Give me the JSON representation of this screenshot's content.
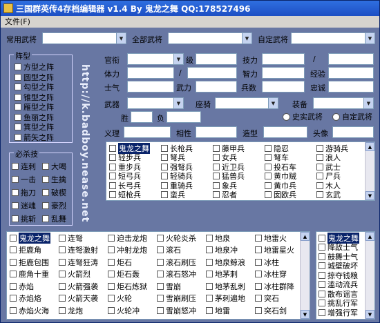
{
  "window": {
    "title": "三国群英传4存档编辑器 v1.4 By 鬼龙之舞 QQ:178527496"
  },
  "menu": {
    "file": "文件(F)"
  },
  "top_row": {
    "common_label": "常用武将",
    "all_label": "全部武将",
    "custom_label": "自定武将"
  },
  "watermark": {
    "url": "http://k.badboy.nease.net"
  },
  "faction_group": {
    "title": "阵型",
    "items": [
      "方型之阵",
      "圆型之阵",
      "勾型之阵",
      "锥型之阵",
      "雁型之阵",
      "鱼丽之阵",
      "箕型之阵",
      "箭矢之阵"
    ]
  },
  "skill_group": {
    "title": "必杀技",
    "left": [
      "连刺",
      "一击",
      "拖刀",
      "迷魂",
      "挑斩"
    ],
    "right": [
      "大喝",
      "生擒",
      "破楔",
      "豪烈",
      "乱舞"
    ]
  },
  "stats": {
    "official": "官衔",
    "level": "级",
    "skill": "技力",
    "slash": "/",
    "hp": "体力",
    "hp_slash": "/",
    "intel": "智力",
    "exp": "经验",
    "morale": "士气",
    "force": "武力",
    "troops": "兵数",
    "loyalty": "忠诚",
    "weapon": "武器",
    "mount": "座骑",
    "equip": "装备",
    "win": "胜",
    "lose": "负",
    "history_radio": "史实武将",
    "custom_radio": "自定武将",
    "righteous": "义理",
    "relation": "相性",
    "model": "造型",
    "portrait": "头像"
  },
  "troop_list": {
    "columns": [
      [
        "鬼龙之舞",
        "轻步兵",
        "重步兵",
        "短弓兵",
        "长弓兵",
        "短枪兵"
      ],
      [
        "长枪兵",
        "弩兵",
        "强弩兵",
        "轻骑兵",
        "重骑兵",
        "蛮兵"
      ],
      [
        "藤甲兵",
        "女兵",
        "近卫兵",
        "猛兽兵",
        "象兵",
        "忍者"
      ],
      [
        "隐忍",
        "弩车",
        "投石车",
        "黄巾贼",
        "黄巾兵",
        "囡欧兵"
      ],
      [
        "游骑兵",
        "浪人",
        "武士",
        "尸兵",
        "木人",
        "玄武"
      ]
    ]
  },
  "skill_list": {
    "columns": [
      [
        "鬼龙之舞",
        "拒鹿角",
        "拒鹿包围",
        "鹿角十重",
        "赤焰",
        "赤焰烙",
        "赤焰火海"
      ],
      [
        "连弩",
        "连弩激射",
        "连弩狂涛",
        "火箭烈",
        "火箭强袭",
        "火箭天袭",
        "龙炮"
      ],
      [
        "迫击龙炮",
        "冲射龙炮",
        "炬石",
        "炬石轰",
        "炬石炼狱",
        "火轮",
        "火轮冲"
      ],
      [
        "火轮炎杀",
        "滚石",
        "滚石刷压",
        "滚石怒冲",
        "雪崩",
        "雪崩刷压",
        "雪崩怒冲"
      ],
      [
        "地泉",
        "地泉冲",
        "地泉鲸浪",
        "地茅刺",
        "地茅乱刺",
        "茅刺遍地",
        "地雷"
      ],
      [
        "地雷火",
        "地雷星火",
        "冰柱",
        "冰柱穿",
        "冰柱群降",
        "突石",
        "突石剑"
      ]
    ]
  },
  "side_list": {
    "items": [
      "鬼龙之舞",
      "降敌士气",
      "鼓舞士气",
      "城壁破坏",
      "掠夺钱粮",
      "滥动流兵",
      "散布谣言",
      "挑乱行军",
      "增强行军"
    ]
  },
  "colors": {
    "bg": "#6877a3",
    "title": "#1d4fc4",
    "select": "#0a246a"
  }
}
